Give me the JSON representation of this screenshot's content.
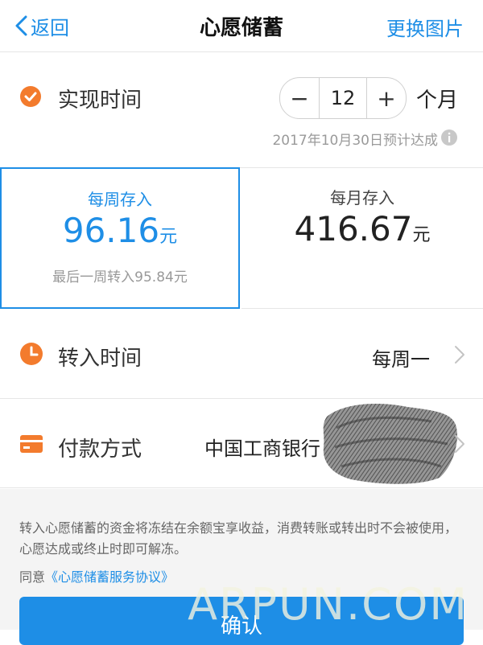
{
  "nav": {
    "back_label": "返回",
    "title": "心愿储蓄",
    "right_label": "更换图片"
  },
  "time": {
    "label": "实现时间",
    "value": "12",
    "unit": "个月",
    "note": "2017年10月30日预计达成"
  },
  "deposit": {
    "weekly": {
      "title": "每周存入",
      "amount": "96.16",
      "unit": "元",
      "sub": "最后一周转入95.84元"
    },
    "monthly": {
      "title": "每月存入",
      "amount": "416.67",
      "unit": "元"
    }
  },
  "transfer": {
    "label": "转入时间",
    "value": "每周一"
  },
  "payment": {
    "label": "付款方式",
    "value": "中国工商银行"
  },
  "agreement": {
    "text": "转入心愿储蓄的资金将冻结在余额宝享收益，消费转账或转出时不会被使用，心愿达成或终止时即可解冻。",
    "prefix": "同意",
    "link": "《心愿储蓄服务协议》"
  },
  "confirm_label": "确认",
  "watermark": "ARPUN.COM",
  "colors": {
    "accent": "#1e8ee6",
    "orange": "#f37b2d",
    "border": "#e6e6e6"
  }
}
